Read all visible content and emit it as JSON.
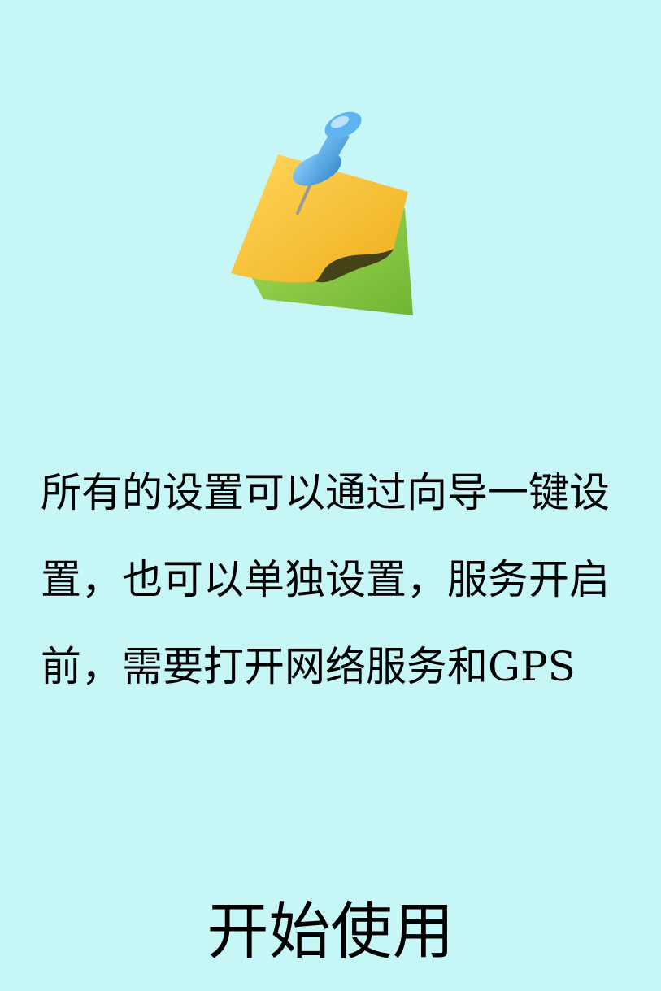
{
  "welcome": {
    "icon": "pinned-note-icon",
    "description": "所有的设置可以通过向导一键设置，也可以单独设置，服务开启前，需要打开网络服务和GPS",
    "start_label": "开始使用"
  },
  "colors": {
    "background": "#c6f7f6",
    "note_yellow": "#f6c232",
    "note_green": "#8ed04a",
    "pin_blue": "#4aa3e0"
  }
}
